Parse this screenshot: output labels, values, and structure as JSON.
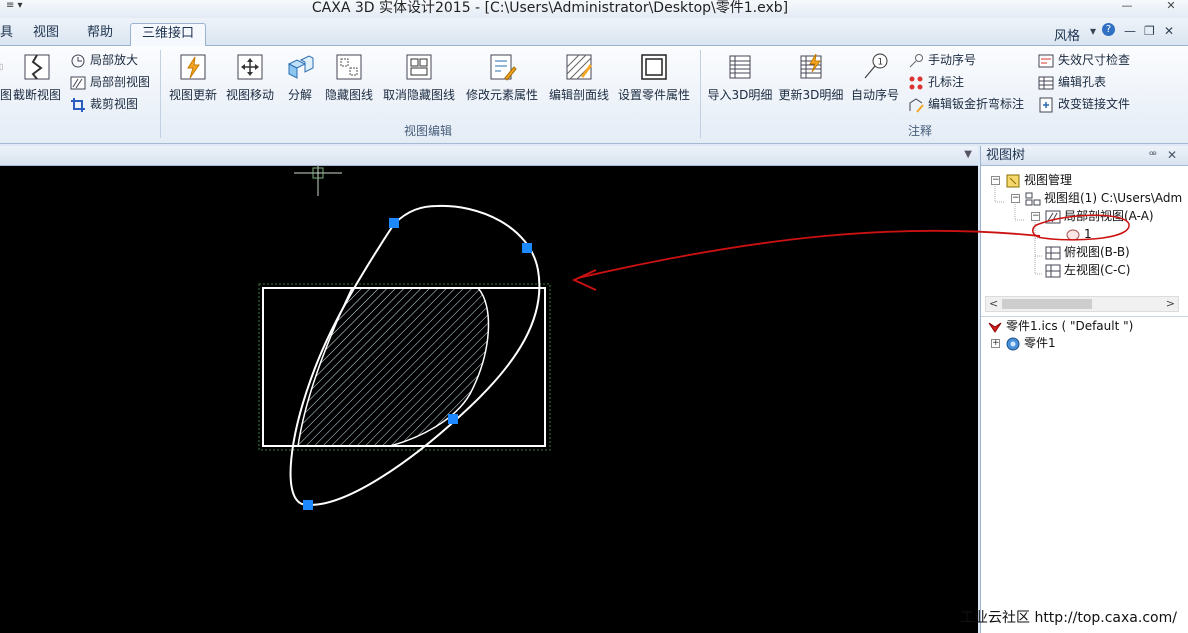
{
  "titlebar": {
    "quick_access": "≡ ▾",
    "title": "CAXA 3D 实体设计2015 - [C:\\Users\\Administrator\\Desktop\\零件1.exb]",
    "min": "—",
    "close": "✕"
  },
  "tabs": [
    {
      "label": "具"
    },
    {
      "label": "视图"
    },
    {
      "label": "帮助"
    },
    {
      "label": "三维接口"
    }
  ],
  "style_menu": {
    "label": "风格",
    "arrow": "▾",
    "help": "?",
    "mini_min": "—",
    "mini_restore": "❐",
    "mini_close": "✕"
  },
  "ribbon": {
    "left_group": {
      "cut_label": "图",
      "section_view": "截断视图",
      "local_zoom": "局部放大",
      "local_section": "局部剖视图",
      "crop_view": "裁剪视图"
    },
    "view_edit_group": {
      "label": "视图编辑",
      "buttons": [
        "视图更新",
        "视图移动",
        "分解",
        "隐藏图线",
        "取消隐藏图线",
        "修改元素属性",
        "编辑剖面线",
        "设置零件属性"
      ]
    },
    "annotation_group": {
      "label": "注释",
      "buttons": [
        "导入3D明细",
        "更新3D明细",
        "自动序号"
      ],
      "small": [
        "手动序号",
        "孔标注",
        "编辑钣金折弯标注",
        "失效尺寸检查",
        "编辑孔表",
        "改变链接文件"
      ]
    }
  },
  "docstrip": {
    "dropdown": "▼"
  },
  "panel": {
    "title": "视图树",
    "pin": "ꟹ",
    "close": "✕",
    "tree": [
      {
        "label": "视图管理"
      },
      {
        "label": "视图组(1)  C:\\Users\\Adm"
      },
      {
        "label": "局部剖视图(A-A)"
      },
      {
        "label": "1"
      },
      {
        "label": "俯视图(B-B)"
      },
      {
        "label": "左视图(C-C)"
      }
    ],
    "scroll_left": "<",
    "scroll_right": ">",
    "file_tree": [
      {
        "label": "零件1.ics ( \"Default \")"
      },
      {
        "label": "零件1"
      }
    ]
  },
  "watermark": "工业云社区 http://top.caxa.com/",
  "colors": {
    "canvas": "#000000",
    "ellipse": "#ffffff",
    "handles": "#1e88ff",
    "hatch": "#cfe6ef",
    "annotation": "#cc1111"
  }
}
